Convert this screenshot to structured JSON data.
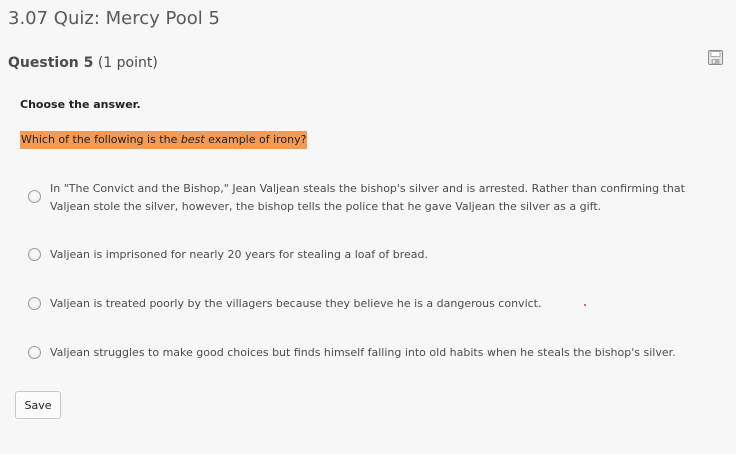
{
  "quiz": {
    "title": "3.07 Quiz: Mercy Pool 5"
  },
  "question": {
    "number_label": "Question 5",
    "points_label": "(1 point)",
    "instruction": "Choose the answer.",
    "prompt_before": "Which of the following is the ",
    "prompt_emphasis": "best",
    "prompt_after": " example of irony?",
    "choices": [
      {
        "text": "In \"The Convict and the Bishop,\" Jean Valjean steals the bishop's silver and is arrested. Rather than confirming that Valjean stole the silver, however, the bishop tells the police that he gave Valjean the silver as a gift."
      },
      {
        "text": "Valjean is imprisoned for nearly 20 years for stealing a loaf of bread."
      },
      {
        "text": "Valjean is treated poorly by the villagers because they believe he is a dangerous convict."
      },
      {
        "text": "Valjean struggles to make good choices but finds himself falling into old habits when he steals the bishop's silver."
      }
    ]
  },
  "toolbar": {
    "save_label": "Save",
    "save_icon": "floppy-disk-icon"
  },
  "colors": {
    "highlight": "#f59a53",
    "background": "#f7f7f7"
  }
}
